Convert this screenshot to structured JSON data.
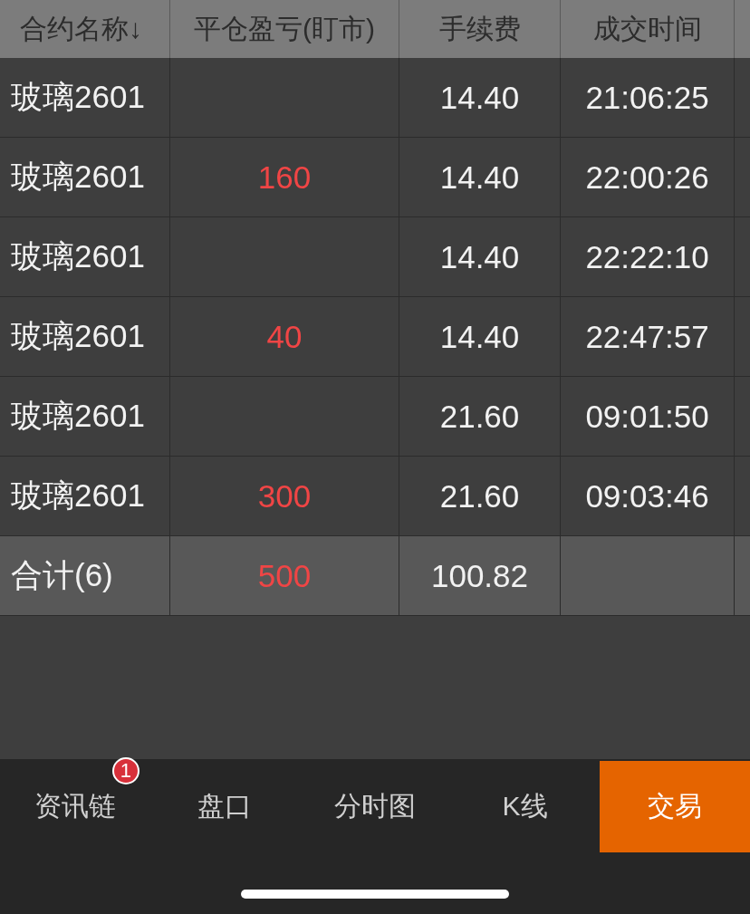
{
  "table": {
    "columns": [
      {
        "label": "合约名称↓"
      },
      {
        "label": "平仓盈亏(盯市)"
      },
      {
        "label": "手续费"
      },
      {
        "label": "成交时间"
      }
    ],
    "rows": [
      {
        "contract": "玻璃2601",
        "fee": "14.40",
        "time": "21:06:25"
      },
      {
        "contract": "玻璃2601",
        "pnl": "160",
        "fee": "14.40",
        "time": "22:00:26"
      },
      {
        "contract": "玻璃2601",
        "fee": "14.40",
        "time": "22:22:10"
      },
      {
        "contract": "玻璃2601",
        "pnl": "40",
        "fee": "14.40",
        "time": "22:47:57"
      },
      {
        "contract": "玻璃2601",
        "fee": "21.60",
        "time": "09:01:50"
      },
      {
        "contract": "玻璃2601",
        "pnl": "300",
        "fee": "21.60",
        "time": "09:03:46"
      }
    ],
    "total": {
      "contract": "合计(6)",
      "pnl": "500",
      "fee": "100.82"
    }
  },
  "tab_bar": [
    {
      "label": "资讯链",
      "selected": false,
      "badge": "1"
    },
    {
      "label": "盘口",
      "selected": false
    },
    {
      "label": "分时图",
      "selected": false
    },
    {
      "label": "K线",
      "selected": false
    },
    {
      "label": "交易",
      "selected": true
    }
  ]
}
